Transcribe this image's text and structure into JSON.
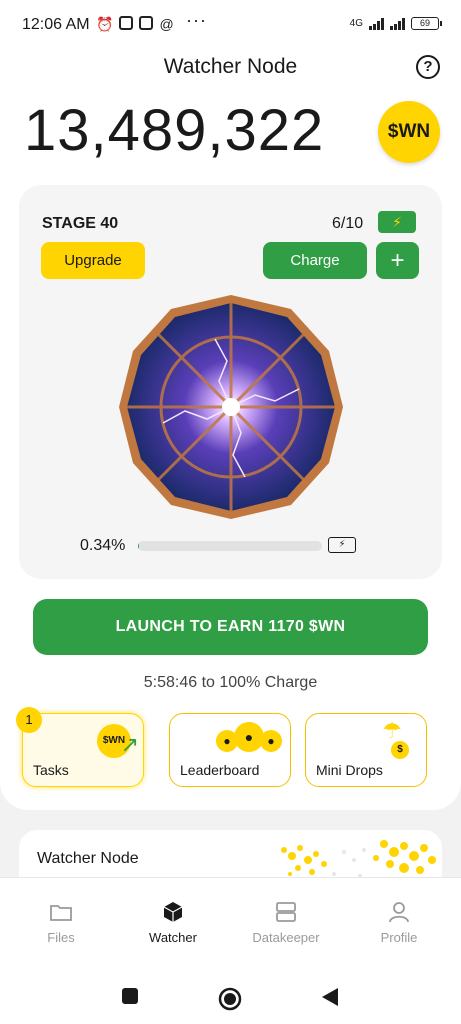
{
  "status_bar": {
    "time": "12:06 AM",
    "network": "4G",
    "battery": "69"
  },
  "header": {
    "title": "Watcher Node",
    "help_icon": "question-circle-icon"
  },
  "balance": {
    "value": "13,489,322",
    "token": "$WN"
  },
  "stage": {
    "label": "STAGE 40",
    "charges": "6/10",
    "upgrade_label": "Upgrade",
    "charge_label": "Charge",
    "plus_label": "+",
    "progress_pct": "0.34%",
    "progress_value": 0.34
  },
  "launch": {
    "label": "LAUNCH TO EARN 1170 $WN"
  },
  "countdown": "5:58:46 to 100% Charge",
  "tiles": [
    {
      "label": "Tasks",
      "badge": "1",
      "coin": "$WN"
    },
    {
      "label": "Leaderboard"
    },
    {
      "label": "Mini Drops",
      "coin": "$"
    }
  ],
  "lower_card": {
    "title": "Watcher Node"
  },
  "nav": {
    "items": [
      {
        "label": "Files",
        "icon": "folder-icon"
      },
      {
        "label": "Watcher",
        "icon": "cube-icon"
      },
      {
        "label": "Datakeeper",
        "icon": "server-icon"
      },
      {
        "label": "Profile",
        "icon": "person-icon"
      }
    ],
    "active": "Watcher"
  },
  "colors": {
    "brand_yellow": "#ffd400",
    "brand_green": "#2f9e44"
  }
}
